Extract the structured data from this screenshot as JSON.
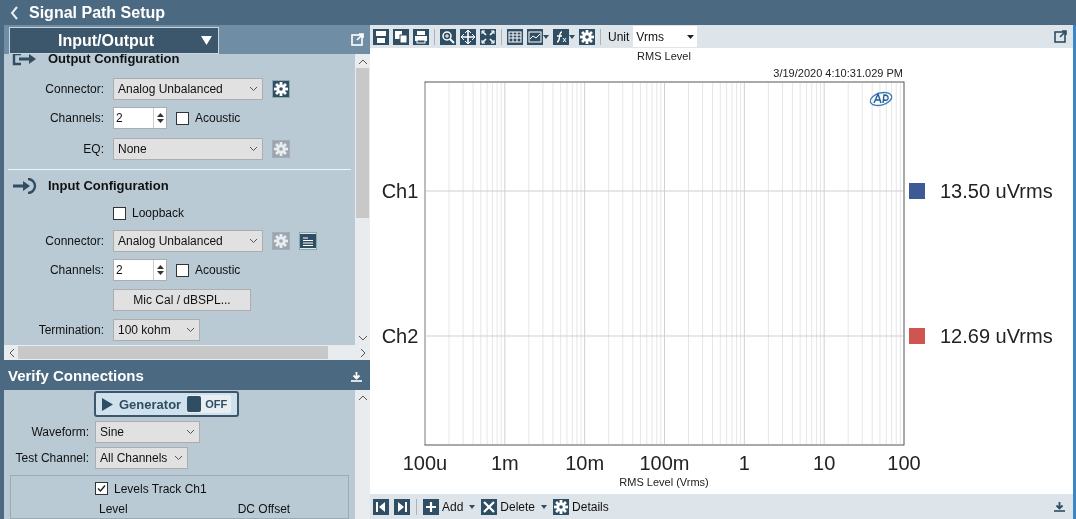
{
  "title": "Signal Path Setup",
  "panel_selector": "Input/Output",
  "output_config": {
    "heading": "Output Configuration",
    "connector_label": "Connector:",
    "connector": "Analog Unbalanced",
    "connector_settings_enabled": true,
    "channels_label": "Channels:",
    "channels": "2",
    "acoustic": {
      "label": "Acoustic",
      "checked": false
    },
    "eq_label": "EQ:",
    "eq": "None",
    "eq_settings_enabled": false
  },
  "input_config": {
    "heading": "Input Configuration",
    "loopback": {
      "label": "Loopback",
      "checked": false
    },
    "connector_label": "Connector:",
    "connector": "Analog Unbalanced",
    "connector_settings_enabled": false,
    "channels_label": "Channels:",
    "channels": "2",
    "acoustic": {
      "label": "Acoustic",
      "checked": false
    },
    "mic_cal_button": "Mic Cal / dBSPL...",
    "termination_label": "Termination:",
    "termination": "100 kohm"
  },
  "verify": {
    "heading": "Verify Connections",
    "generator": {
      "label": "Generator",
      "state": "OFF",
      "on": false
    },
    "waveform_label": "Waveform:",
    "waveform": "Sine",
    "test_channel_label": "Test Channel:",
    "test_channel": "All Channels",
    "levels_track": {
      "label": "Levels Track Ch1",
      "checked": true
    },
    "column_1": "Level",
    "column_2": "DC Offset"
  },
  "toolbar": {
    "unit_label": "Unit",
    "unit": "Vrms"
  },
  "chart": {
    "title": "RMS Level",
    "timestamp": "3/19/2020 4:10:31.029 PM",
    "x_axis_title": "RMS Level (Vrms)",
    "x_tick_labels": [
      "100u",
      "1m",
      "10m",
      "100m",
      "1",
      "10",
      "100"
    ],
    "channels": [
      {
        "label": "Ch1",
        "reading": "13.50 uVrms",
        "color": "#3c5a96"
      },
      {
        "label": "Ch2",
        "reading": "12.69 uVrms",
        "color": "#cf5650"
      }
    ]
  },
  "bottom_toolbar": [
    {
      "label": "Add",
      "kind": "add",
      "dropdown": true
    },
    {
      "label": "Delete",
      "kind": "delete",
      "dropdown": true
    },
    {
      "label": "Details",
      "kind": "details",
      "dropdown": false
    }
  ]
}
